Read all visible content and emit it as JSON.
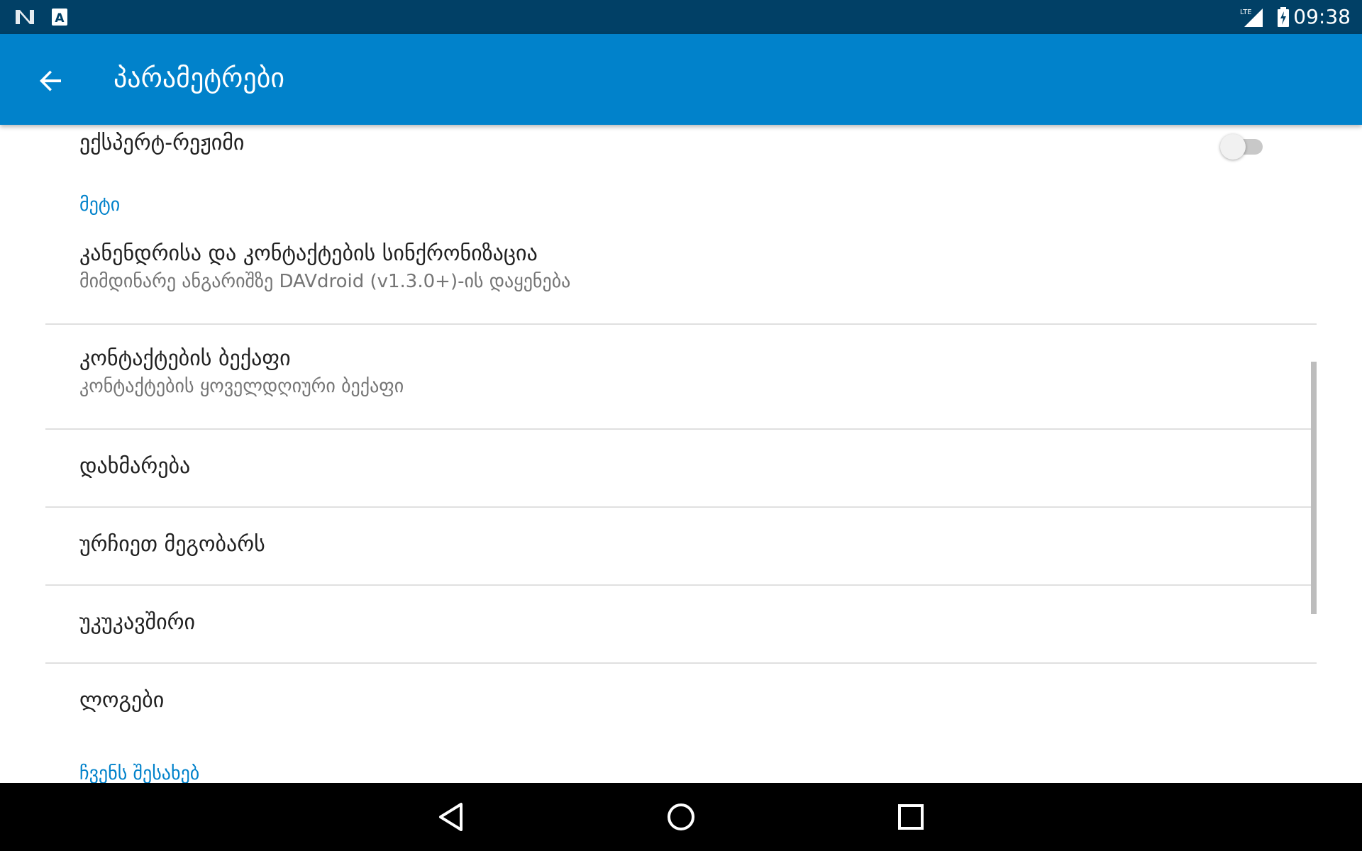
{
  "status_bar": {
    "time": "09:38",
    "icons": [
      "notification-n-icon",
      "keyboard-a-icon",
      "lte-signal-icon",
      "battery-charging-icon"
    ]
  },
  "app_bar": {
    "title": "პარამეტრები",
    "back_icon": "arrow-back-icon"
  },
  "preferences": {
    "expert_mode": {
      "title": "ექსპერტ-რეჟიმი",
      "enabled": false
    },
    "category_more": "მეტი",
    "calendar_sync": {
      "title": "კანენდრისა და კონტაქტების სინქრონიზაცია",
      "summary": "მიმდინარე ანგარიშზე DAVdroid (v1.3.0+)-ის დაყენება"
    },
    "contacts_backup": {
      "title": "კონტაქტების ბექაფი",
      "summary": "კონტაქტების ყოველდღიური ბექაფი"
    },
    "help": {
      "title": "დახმარება"
    },
    "recommend": {
      "title": "ურჩიეთ მეგობარს"
    },
    "feedback": {
      "title": "უკუკავშირი"
    },
    "logs": {
      "title": "ლოგები"
    },
    "category_about": "ჩვენს შესახებ"
  },
  "nav_bar": {
    "icons": [
      "back-triangle-icon",
      "home-circle-icon",
      "recents-square-icon"
    ]
  },
  "colors": {
    "status_bar": "#014066",
    "app_bar": "#0182cb",
    "accent": "#0182cb",
    "divider": "#e0e0e0"
  }
}
